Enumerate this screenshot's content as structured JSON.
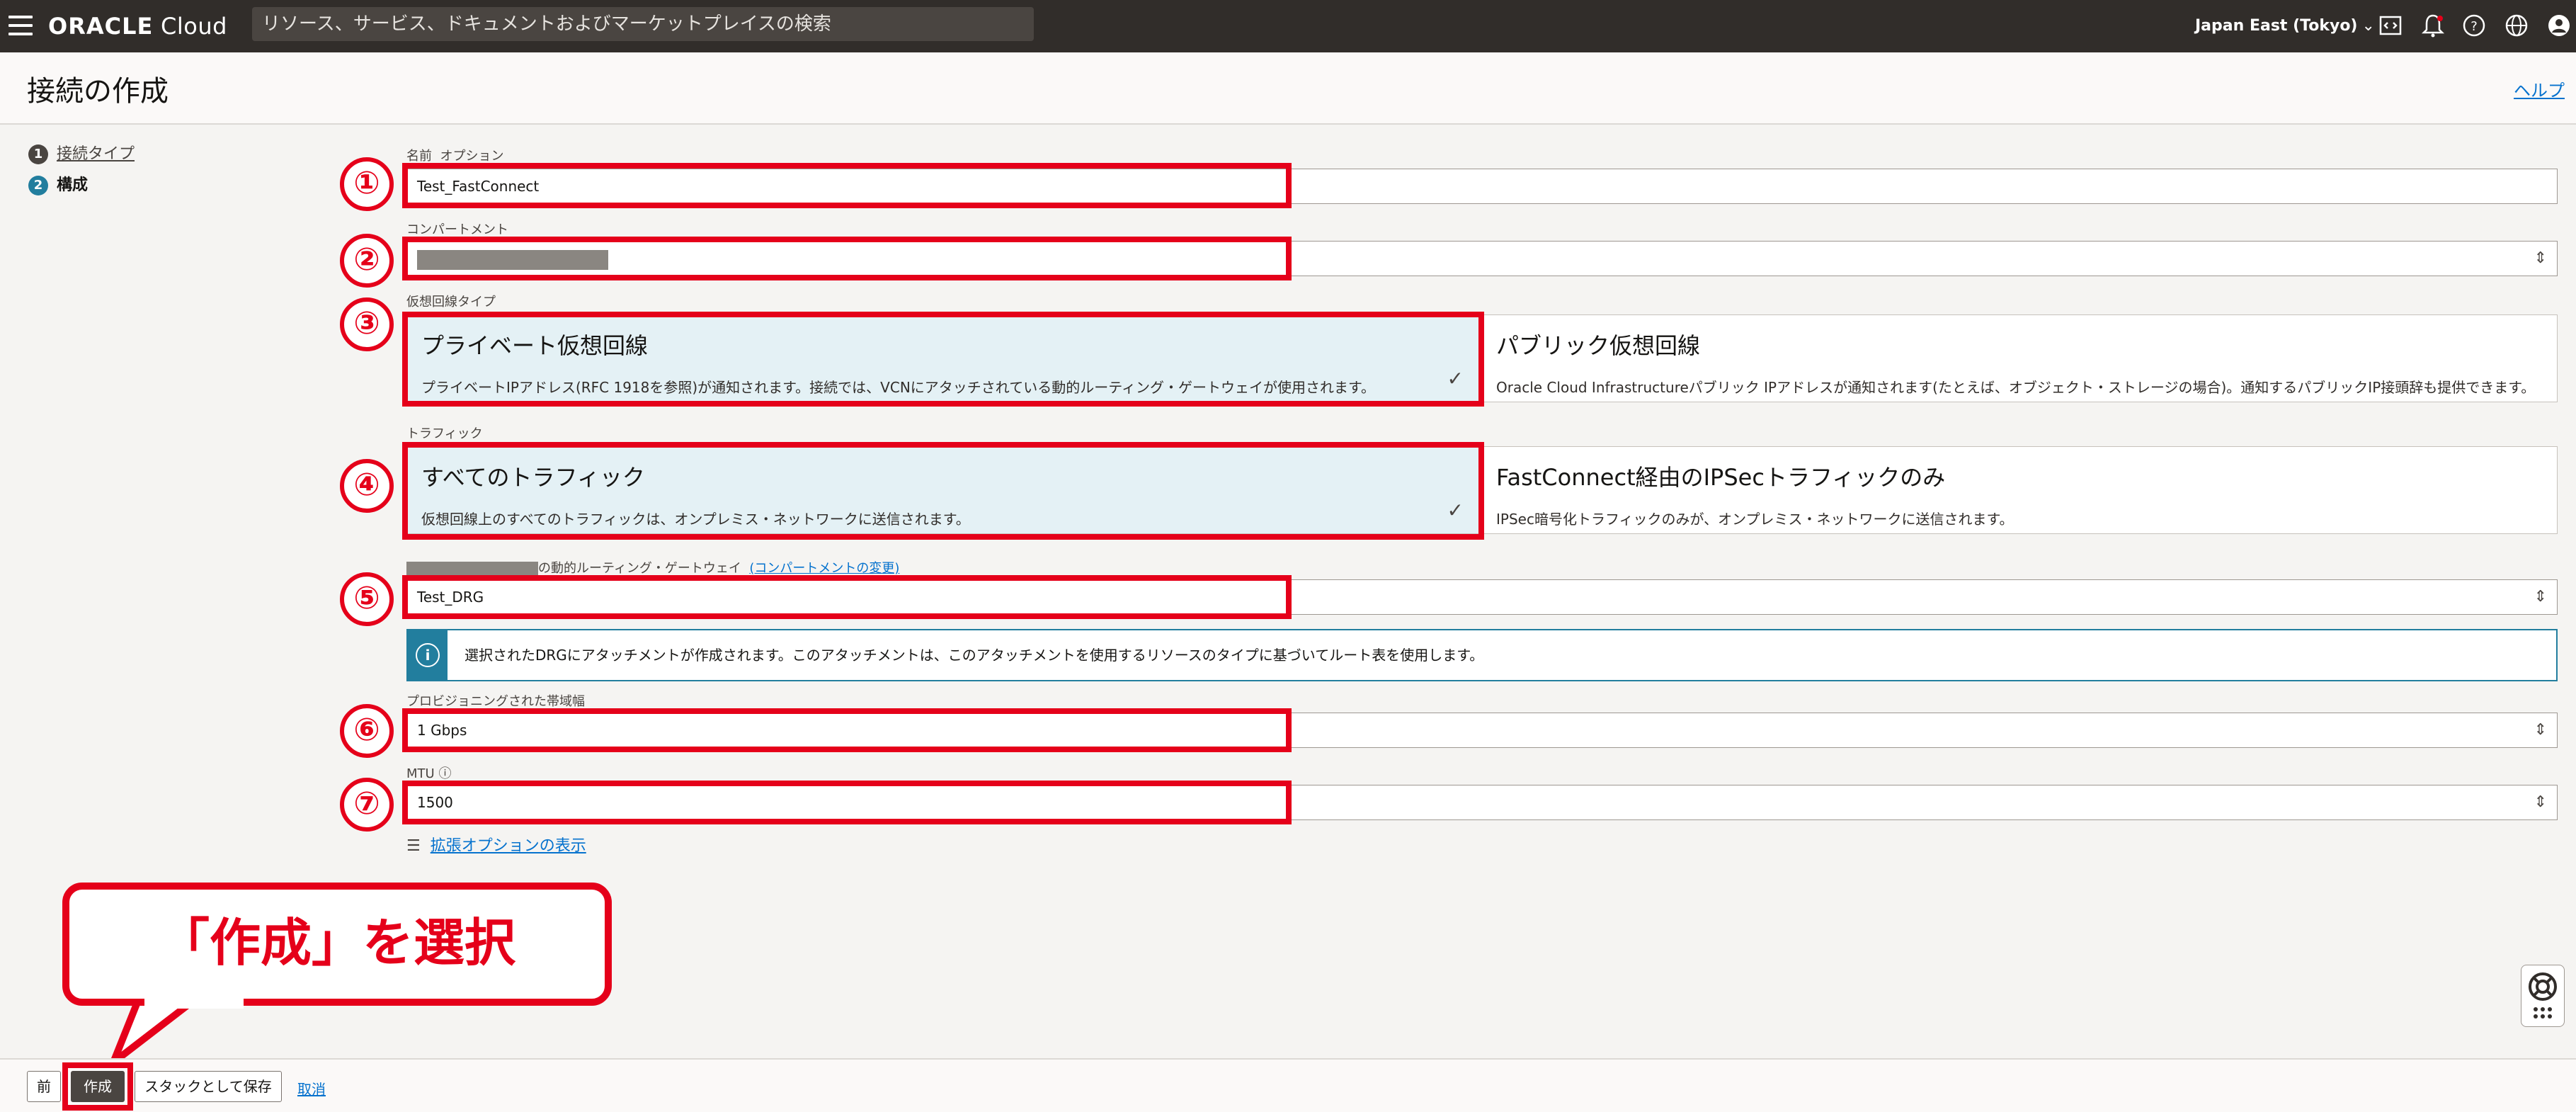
{
  "topbar": {
    "brand_bold": "ORACLE",
    "brand_light": " Cloud",
    "search_placeholder": "リソース、サービス、ドキュメントおよびマーケットプレイスの検索",
    "region": "Japan East (Tokyo)",
    "icons": [
      "menu-icon",
      "code-editor-icon",
      "notification-bell-icon",
      "help-icon",
      "language-globe-icon",
      "user-avatar-icon"
    ]
  },
  "page": {
    "title": "接続の作成",
    "help": "ヘルプ"
  },
  "steps": [
    {
      "num": "1",
      "label": "接続タイプ"
    },
    {
      "num": "2",
      "label": "構成"
    }
  ],
  "form": {
    "name": {
      "label": "名前",
      "optional": "オプション",
      "value": "Test_FastConnect"
    },
    "compartment": {
      "label": "コンパートメント"
    },
    "vc_type": {
      "label": "仮想回線タイプ",
      "private": {
        "title": "プライベート仮想回線",
        "desc": "プライベートIPアドレス(RFC 1918を参照)が通知されます。接続では、VCNにアタッチされている動的ルーティング・ゲートウェイが使用されます。",
        "selected": true
      },
      "public": {
        "title": "パブリック仮想回線",
        "desc": "Oracle Cloud Infrastructureパブリック IPアドレスが通知されます(たとえば、オブジェクト・ストレージの場合)。通知するパブリックIP接頭辞も提供できます。",
        "selected": false
      }
    },
    "traffic": {
      "label": "トラフィック",
      "all": {
        "title": "すべてのトラフィック",
        "desc": "仮想回線上のすべてのトラフィックは、オンプレミス・ネットワークに送信されます。",
        "selected": true
      },
      "ipsec": {
        "title": "FastConnect経由のIPSecトラフィックのみ",
        "desc": "IPSec暗号化トラフィックのみが、オンプレミス・ネットワークに送信されます。",
        "selected": false
      }
    },
    "drg": {
      "label_suffix": "の動的ルーティング・ゲートウェイ",
      "change_link": "(コンパートメントの変更)",
      "value": "Test_DRG"
    },
    "info": "選択されたDRGにアタッチメントが作成されます。このアタッチメントは、このアタッチメントを使用するリソースのタイプに基づいてルート表を使用します。",
    "bandwidth": {
      "label": "プロビジョニングされた帯域幅",
      "value": "1 Gbps"
    },
    "mtu": {
      "label": "MTU",
      "value": "1500"
    },
    "advanced": "拡張オプションの表示"
  },
  "annotations": {
    "numbers": [
      "①",
      "②",
      "③",
      "④",
      "⑤",
      "⑥",
      "⑦"
    ],
    "callout": "「作成」を選択",
    "color": "#e5001a"
  },
  "buttons": {
    "prev": "前",
    "create": "作成",
    "save_stack": "スタックとして保存",
    "cancel": "取消"
  },
  "colors": {
    "topbar": "#312d2a",
    "accent": "#227e9e",
    "link": "#0572ce",
    "selected_card": "#e4f1f5"
  }
}
